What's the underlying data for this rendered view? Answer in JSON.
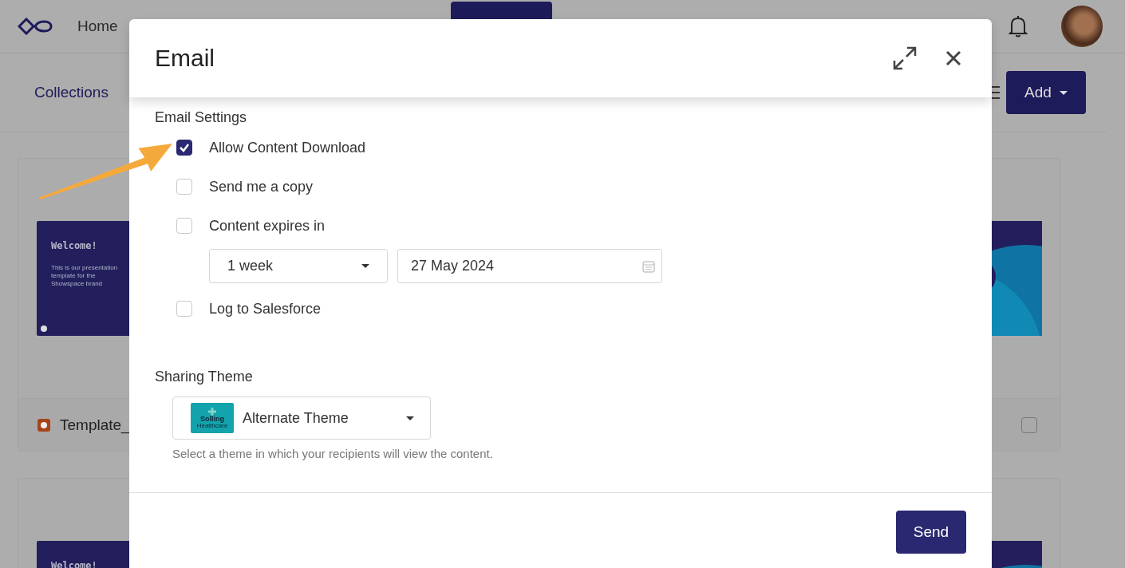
{
  "top_nav": {
    "items": [
      {
        "label": "Home",
        "selected": false
      }
    ]
  },
  "toolbar": {
    "breadcrumb": "Collections",
    "add_button": "Add"
  },
  "cards": [
    {
      "kind": "slide",
      "slide_title": "Welcome!",
      "slide_text": "This is our presentation template for the Showspace brand",
      "name": "Template_"
    },
    {
      "kind": "picture",
      "checked": false
    },
    {
      "kind": "slide",
      "slide_title": "Welcome!"
    },
    {
      "kind": "picture"
    }
  ],
  "dialog": {
    "title": "Email",
    "section_label": "Email Settings",
    "options": [
      {
        "label": "Allow Content Download",
        "checked": true
      },
      {
        "label": "Send me a copy",
        "checked": false
      },
      {
        "label": "Content expires in",
        "checked": false,
        "expiry": {
          "duration": "1 week",
          "date": "27 May 2024"
        }
      },
      {
        "label": "Log to Salesforce",
        "checked": false
      }
    ],
    "theme_label": "Sharing Theme",
    "theme": {
      "value": "Alternate Theme",
      "thumbnail_title": "Solling",
      "thumbnail_subtitle": "Healthcare"
    },
    "theme_hint": "Select a theme in which your recipients will view the content.",
    "send_button": "Send"
  }
}
